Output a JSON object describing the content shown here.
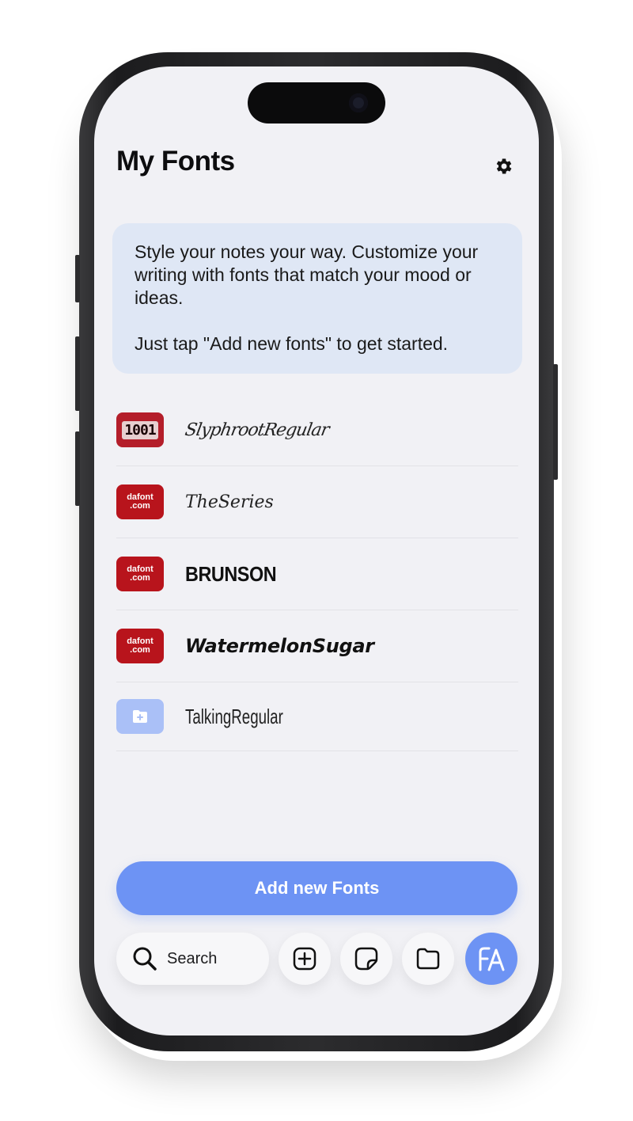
{
  "header": {
    "title": "My Fonts",
    "settings_icon": "gear-icon"
  },
  "info_card": {
    "line1": "Style your notes your way. Customize your writing with fonts that match your mood or ideas.",
    "line2": "Just tap \"Add new fonts\" to get started."
  },
  "fonts": [
    {
      "name": "SlyphrootRegular",
      "source_badge": "1001",
      "badge_color": "#b41e2a"
    },
    {
      "name": "TheSeries",
      "source_badge_line1": "dafont",
      "source_badge_line2": ".com",
      "badge_color": "#b8141c"
    },
    {
      "name": "BRUNSON",
      "source_badge_line1": "dafont",
      "source_badge_line2": ".com",
      "badge_color": "#b8141c"
    },
    {
      "name": "WatermelonSugar",
      "source_badge_line1": "dafont",
      "source_badge_line2": ".com",
      "badge_color": "#b8141c"
    },
    {
      "name": "TalkingRegular",
      "source_icon": "folder-plus-icon",
      "badge_color": "#aac0f7"
    }
  ],
  "add_button": {
    "label": "Add new Fonts",
    "color": "#6d93f4"
  },
  "tabbar": {
    "search_label": "Search",
    "icons": [
      "search-icon",
      "add-square-icon",
      "sticker-icon",
      "folder-icon",
      "fonts-icon"
    ],
    "active": "fonts"
  }
}
